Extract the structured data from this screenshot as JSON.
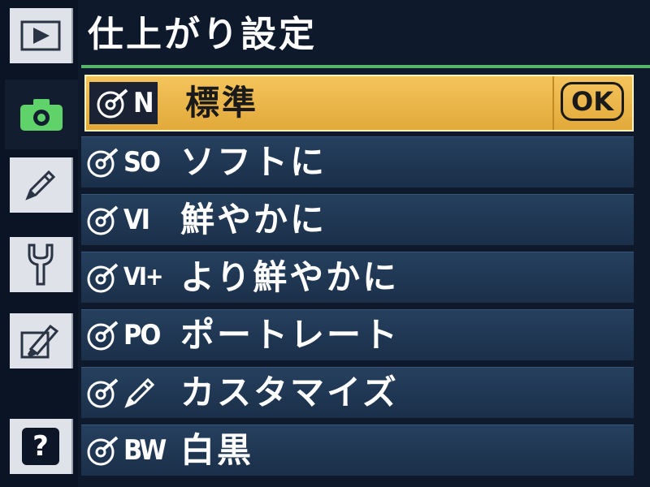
{
  "sidebar": {
    "tabs": [
      {
        "name": "playback-tab",
        "icon": "play-icon"
      },
      {
        "name": "shooting-tab",
        "icon": "camera-icon",
        "active": true
      },
      {
        "name": "custom-settings-tab",
        "icon": "pencil-icon"
      },
      {
        "name": "setup-tab",
        "icon": "wrench-icon"
      },
      {
        "name": "retouch-tab",
        "icon": "retouch-brush-icon"
      },
      {
        "name": "help-tab",
        "icon": "help-icon",
        "label": "?"
      }
    ]
  },
  "header": {
    "title": "仕上がり設定"
  },
  "menu": {
    "items": [
      {
        "code": "N",
        "label": "標準",
        "selected": true,
        "confirm": "OK"
      },
      {
        "code": "SO",
        "label": "ソフトに"
      },
      {
        "code": "VI",
        "label": "鮮やかに"
      },
      {
        "code": "VI+",
        "label": "より鮮やかに"
      },
      {
        "code": "PO",
        "label": "ポートレート"
      },
      {
        "code": "",
        "label": "カスタマイズ"
      },
      {
        "code": "BW",
        "label": "白黒"
      }
    ]
  },
  "colors": {
    "accent_rule": "#55b46a",
    "selected_bg": "#f0bc52",
    "item_bg": "#22395a",
    "active_tab_icon": "#5fd36a"
  }
}
